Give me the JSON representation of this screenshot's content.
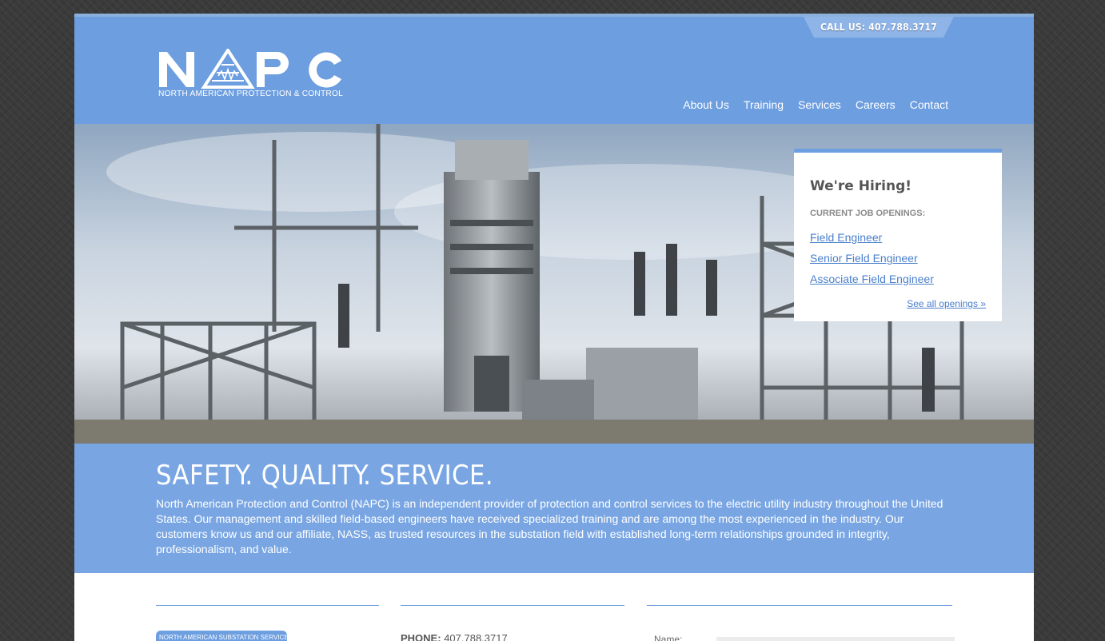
{
  "header": {
    "call_us": "CALL US: 407.788.3717",
    "logo_letters": "NAPC",
    "logo_tagline": "NORTH AMERICAN PROTECTION & CONTROL",
    "nav": [
      "About Us",
      "Training",
      "Services",
      "Careers",
      "Contact"
    ]
  },
  "hiring": {
    "title": "We're Hiring!",
    "subtitle": "CURRENT JOB OPENINGS:",
    "jobs": [
      "Field Engineer",
      "Senior Field Engineer",
      "Associate Field Engineer"
    ],
    "see_all": "See all openings »"
  },
  "intro": {
    "headline": "SAFETY. QUALITY. SERVICE.",
    "body": "North American Protection and Control (NAPC) is an independent provider of protection and control services to the electric utility industry throughout the United States. Our management and skilled field-based engineers have received specialized training and are among the most experienced in the industry. Our customers know us and our affiliate, NASS, as trusted resources in the substation field with established long-term relationships grounded in integrity, professionalism, and value."
  },
  "footer": {
    "affiliate_logo_text": "NORTH AMERICAN SUBSTATION SERVICES",
    "phone_label": "PHONE:",
    "phone_value": "407.788.3717",
    "name_label": "Name:"
  },
  "colors": {
    "header_blue": "#6d9ee0",
    "band_blue": "#79a6e3",
    "link_blue": "#4a7fcc"
  }
}
